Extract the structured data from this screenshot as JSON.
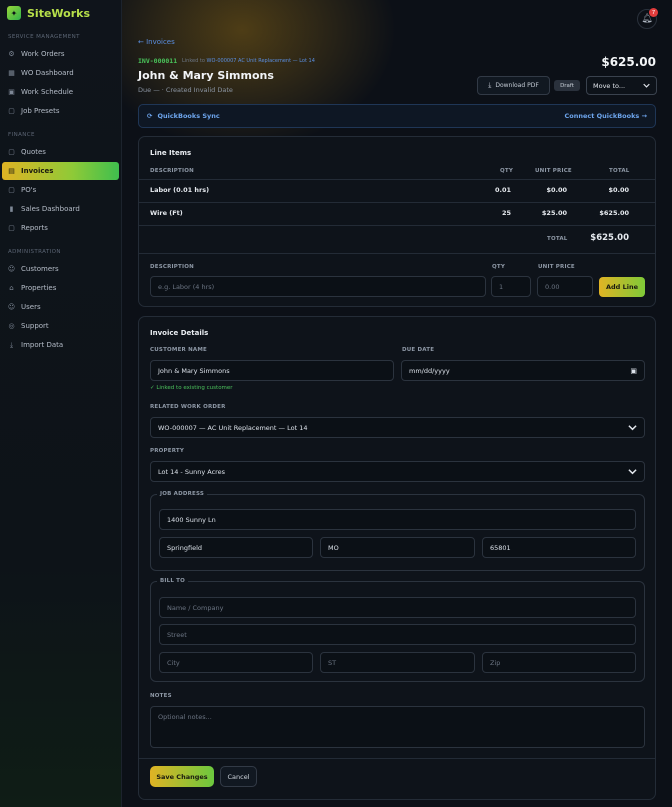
{
  "brand": {
    "name": "SiteWorks",
    "logo_glyph": "✦"
  },
  "sidebar": {
    "sections": [
      {
        "title": "SERVICE MANAGEMENT",
        "items": [
          {
            "label": "Work Orders",
            "icon": "wrench-icon"
          },
          {
            "label": "WO Dashboard",
            "icon": "grid-icon"
          },
          {
            "label": "Work Schedule",
            "icon": "calendar-icon"
          },
          {
            "label": "Job Presets",
            "icon": "document-icon"
          }
        ]
      },
      {
        "title": "FINANCE",
        "items": [
          {
            "label": "Quotes",
            "icon": "document-icon"
          },
          {
            "label": "Invoices",
            "icon": "invoice-icon",
            "active": true
          },
          {
            "label": "PO's",
            "icon": "document-icon"
          },
          {
            "label": "Sales Dashboard",
            "icon": "bar-chart-icon"
          },
          {
            "label": "Reports",
            "icon": "report-icon"
          }
        ]
      },
      {
        "title": "ADMINISTRATION",
        "items": [
          {
            "label": "Customers",
            "icon": "users-icon"
          },
          {
            "label": "Properties",
            "icon": "home-icon"
          },
          {
            "label": "Users",
            "icon": "user-icon"
          },
          {
            "label": "Support",
            "icon": "lifebuoy-icon"
          },
          {
            "label": "Import Data",
            "icon": "download-icon"
          }
        ]
      }
    ]
  },
  "header": {
    "notifications_count": "7",
    "back_link": "← Invoices",
    "invoice_number": "INV-000011",
    "linked_prefix": "Linked to",
    "linked_work_order": "WO-000007 AC Unit Replacement — Lot 14",
    "client_name": "John & Mary Simmons",
    "subline": "Due — · Created Invalid Date",
    "total_amount": "$625.00",
    "download_pdf": "Download PDF",
    "status_badge": "Draft",
    "move_to": "Move to..."
  },
  "quickbooks": {
    "label": "QuickBooks Sync",
    "connect": "Connect QuickBooks →"
  },
  "line_items": {
    "title": "Line Items",
    "columns": [
      "DESCRIPTION",
      "QTY",
      "UNIT PRICE",
      "TOTAL"
    ],
    "rows": [
      {
        "description": "Labor (0.01 hrs)",
        "qty": "0.01",
        "unit_price": "$0.00",
        "total": "$0.00"
      },
      {
        "description": "Wire (Ft)",
        "qty": "25",
        "unit_price": "$25.00",
        "total": "$625.00"
      }
    ],
    "total_label": "TOTAL",
    "total_value": "$625.00",
    "new_line": {
      "description_label": "DESCRIPTION",
      "description_placeholder": "e.g. Labor (4 hrs)",
      "qty_label": "QTY",
      "qty_value": "1",
      "unit_price_label": "UNIT PRICE",
      "unit_price_placeholder": "0.00",
      "add_button": "Add Line"
    }
  },
  "invoice_details": {
    "title": "Invoice Details",
    "customer_label": "CUSTOMER NAME",
    "customer_value": "John & Mary Simmons",
    "linked_note": "✓ Linked to existing customer",
    "due_date_label": "DUE DATE",
    "due_date_placeholder": "mm/dd/yyyy",
    "work_order_label": "RELATED WORK ORDER",
    "work_order_value": "WO-000007 — AC Unit Replacement — Lot 14",
    "property_label": "PROPERTY",
    "property_value": "Lot 14 - Sunny Acres",
    "job_address": {
      "legend": "JOB ADDRESS",
      "street": "1400 Sunny Ln",
      "city": "Springfield",
      "state": "MO",
      "zip": "65801"
    },
    "bill_to": {
      "legend": "BILL TO",
      "name_placeholder": "Name / Company",
      "street_placeholder": "Street",
      "city_placeholder": "City",
      "state_placeholder": "ST",
      "zip_placeholder": "Zip"
    },
    "notes_label": "NOTES",
    "notes_placeholder": "Optional notes...",
    "save_button": "Save Changes",
    "cancel_button": "Cancel"
  },
  "colors": {
    "accent_green": "#49c25a",
    "accent_yellow": "#e0b324",
    "link_blue": "#5a8ee0",
    "badge_red": "#e23c3c"
  }
}
